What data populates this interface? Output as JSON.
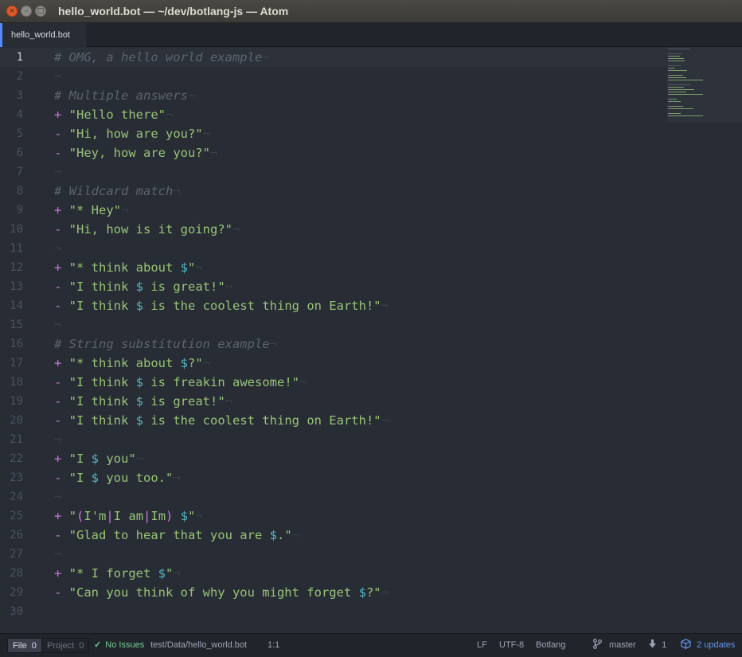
{
  "window": {
    "title": "hello_world.bot — ~/dev/botlang-js — Atom",
    "close_glyph": "×",
    "min_glyph": "–",
    "max_glyph": "□"
  },
  "tabs": [
    {
      "label": "hello_world.bot",
      "active": true
    }
  ],
  "editor": {
    "eol_glyph": "¬",
    "cursor_line": 1,
    "lines": [
      {
        "n": "1",
        "tokens": [
          {
            "t": "# OMG, a hello world example",
            "c": "comment"
          }
        ],
        "eol": true
      },
      {
        "n": "2",
        "tokens": [],
        "eol": true
      },
      {
        "n": "3",
        "tokens": [
          {
            "t": "# Multiple answers",
            "c": "comment"
          }
        ],
        "eol": true
      },
      {
        "n": "4",
        "tokens": [
          {
            "t": "+ ",
            "c": "plus"
          },
          {
            "t": "\"Hello there\"",
            "c": "str"
          }
        ],
        "eol": true
      },
      {
        "n": "5",
        "tokens": [
          {
            "t": "- ",
            "c": "minus"
          },
          {
            "t": "\"Hi, how are you?\"",
            "c": "str"
          }
        ],
        "eol": true
      },
      {
        "n": "6",
        "tokens": [
          {
            "t": "- ",
            "c": "minus"
          },
          {
            "t": "\"Hey, how are you?\"",
            "c": "str"
          }
        ],
        "eol": true
      },
      {
        "n": "7",
        "tokens": [],
        "eol": true
      },
      {
        "n": "8",
        "tokens": [
          {
            "t": "# Wildcard match",
            "c": "comment"
          }
        ],
        "eol": true
      },
      {
        "n": "9",
        "tokens": [
          {
            "t": "+ ",
            "c": "plus"
          },
          {
            "t": "\"* Hey\"",
            "c": "str"
          }
        ],
        "eol": true
      },
      {
        "n": "10",
        "tokens": [
          {
            "t": "- ",
            "c": "minus"
          },
          {
            "t": "\"Hi, how is it going?\"",
            "c": "str"
          }
        ],
        "eol": true
      },
      {
        "n": "11",
        "tokens": [],
        "eol": true
      },
      {
        "n": "12",
        "tokens": [
          {
            "t": "+ ",
            "c": "plus"
          },
          {
            "t": "\"* think about ",
            "c": "str"
          },
          {
            "t": "$",
            "c": "var"
          },
          {
            "t": "\"",
            "c": "str"
          }
        ],
        "eol": true
      },
      {
        "n": "13",
        "tokens": [
          {
            "t": "- ",
            "c": "minus"
          },
          {
            "t": "\"I think ",
            "c": "str"
          },
          {
            "t": "$",
            "c": "var"
          },
          {
            "t": " is great!\"",
            "c": "str"
          }
        ],
        "eol": true
      },
      {
        "n": "14",
        "tokens": [
          {
            "t": "- ",
            "c": "minus"
          },
          {
            "t": "\"I think ",
            "c": "str"
          },
          {
            "t": "$",
            "c": "var"
          },
          {
            "t": " is the coolest thing on Earth!\"",
            "c": "str"
          }
        ],
        "eol": true
      },
      {
        "n": "15",
        "tokens": [],
        "eol": true
      },
      {
        "n": "16",
        "tokens": [
          {
            "t": "# String substitution example",
            "c": "comment"
          }
        ],
        "eol": true
      },
      {
        "n": "17",
        "tokens": [
          {
            "t": "+ ",
            "c": "plus"
          },
          {
            "t": "\"* think about ",
            "c": "str"
          },
          {
            "t": "$",
            "c": "var"
          },
          {
            "t": "?\"",
            "c": "str"
          }
        ],
        "eol": true
      },
      {
        "n": "18",
        "tokens": [
          {
            "t": "- ",
            "c": "minus"
          },
          {
            "t": "\"I think ",
            "c": "str"
          },
          {
            "t": "$",
            "c": "var"
          },
          {
            "t": " is freakin awesome!\"",
            "c": "str"
          }
        ],
        "eol": true
      },
      {
        "n": "19",
        "tokens": [
          {
            "t": "- ",
            "c": "minus"
          },
          {
            "t": "\"I think ",
            "c": "str"
          },
          {
            "t": "$",
            "c": "var"
          },
          {
            "t": " is great!\"",
            "c": "str"
          }
        ],
        "eol": true
      },
      {
        "n": "20",
        "tokens": [
          {
            "t": "- ",
            "c": "minus"
          },
          {
            "t": "\"I think ",
            "c": "str"
          },
          {
            "t": "$",
            "c": "var"
          },
          {
            "t": " is the coolest thing on Earth!\"",
            "c": "str"
          }
        ],
        "eol": true
      },
      {
        "n": "21",
        "tokens": [],
        "eol": true
      },
      {
        "n": "22",
        "tokens": [
          {
            "t": "+ ",
            "c": "plus"
          },
          {
            "t": "\"I ",
            "c": "str"
          },
          {
            "t": "$",
            "c": "var"
          },
          {
            "t": " you\"",
            "c": "str"
          }
        ],
        "eol": true
      },
      {
        "n": "23",
        "tokens": [
          {
            "t": "- ",
            "c": "minus"
          },
          {
            "t": "\"I ",
            "c": "str"
          },
          {
            "t": "$",
            "c": "var"
          },
          {
            "t": " you too.\"",
            "c": "str"
          }
        ],
        "eol": true
      },
      {
        "n": "24",
        "tokens": [],
        "eol": true
      },
      {
        "n": "25",
        "tokens": [
          {
            "t": "+ ",
            "c": "plus"
          },
          {
            "t": "\"",
            "c": "str"
          },
          {
            "t": "(",
            "c": "alt"
          },
          {
            "t": "I'm",
            "c": "str"
          },
          {
            "t": "|",
            "c": "alt"
          },
          {
            "t": "I am",
            "c": "str"
          },
          {
            "t": "|",
            "c": "alt"
          },
          {
            "t": "Im",
            "c": "str"
          },
          {
            "t": ")",
            "c": "alt"
          },
          {
            "t": " ",
            "c": "str"
          },
          {
            "t": "$",
            "c": "var"
          },
          {
            "t": "\"",
            "c": "str"
          }
        ],
        "eol": true
      },
      {
        "n": "26",
        "tokens": [
          {
            "t": "- ",
            "c": "minus"
          },
          {
            "t": "\"Glad to hear that you are ",
            "c": "str"
          },
          {
            "t": "$",
            "c": "var"
          },
          {
            "t": ".\"",
            "c": "str"
          }
        ],
        "eol": true
      },
      {
        "n": "27",
        "tokens": [],
        "eol": true
      },
      {
        "n": "28",
        "tokens": [
          {
            "t": "+ ",
            "c": "plus"
          },
          {
            "t": "\"* I forget ",
            "c": "str"
          },
          {
            "t": "$",
            "c": "var"
          },
          {
            "t": "\"",
            "c": "str"
          }
        ],
        "eol": true
      },
      {
        "n": "29",
        "tokens": [
          {
            "t": "- ",
            "c": "minus"
          },
          {
            "t": "\"Can you think of why you might forget ",
            "c": "str"
          },
          {
            "t": "$",
            "c": "var"
          },
          {
            "t": "?\"",
            "c": "str"
          }
        ],
        "eol": true
      },
      {
        "n": "30",
        "tokens": [],
        "eol": false
      }
    ]
  },
  "status": {
    "file_tab": "File",
    "file_count": "0",
    "project_tab": "Project",
    "project_count": "0",
    "issues": "No Issues",
    "issues_icon": "✓",
    "path": "test/Data/hello_world.bot",
    "cursor": "1:1",
    "line_ending": "LF",
    "encoding": "UTF-8",
    "grammar": "Botlang",
    "branch": "master",
    "pull_count": "1",
    "updates": "2 updates"
  },
  "colors": {
    "background": "#282c34",
    "comment": "#5c6370",
    "string": "#98c379",
    "keyword": "#c678dd",
    "variable": "#56b6c2",
    "accent": "#528bff"
  }
}
